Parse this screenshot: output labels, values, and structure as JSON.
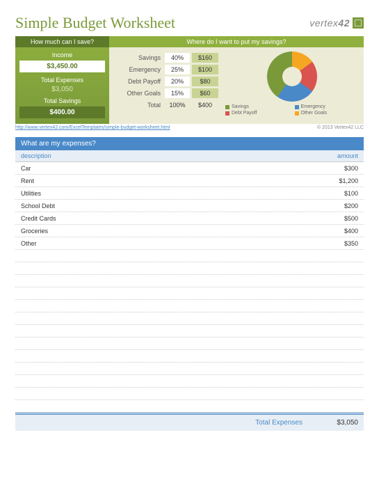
{
  "title": "Simple Budget Worksheet",
  "logo_text": "vertex",
  "logo_suffix": "42",
  "left": {
    "header": "How much can I save?",
    "income_label": "Income",
    "income_value": "$3,450.00",
    "expenses_label": "Total Expenses",
    "expenses_value": "$3,050",
    "savings_label": "Total Savings",
    "savings_value": "$400.00"
  },
  "right": {
    "header": "Where do I want to put my savings?",
    "rows": [
      {
        "label": "Savings",
        "pct": "40%",
        "amt": "$160"
      },
      {
        "label": "Emergency",
        "pct": "25%",
        "amt": "$100"
      },
      {
        "label": "Debt Payoff",
        "pct": "20%",
        "amt": "$80"
      },
      {
        "label": "Other Goals",
        "pct": "15%",
        "amt": "$60"
      }
    ],
    "total_label": "Total",
    "total_pct": "100%",
    "total_amt": "$400"
  },
  "chart_data": {
    "type": "pie",
    "title": "",
    "categories": [
      "Savings",
      "Emergency",
      "Debt Payoff",
      "Other Goals"
    ],
    "values": [
      40,
      25,
      20,
      15
    ],
    "colors": [
      "#7a9a3a",
      "#4a89c8",
      "#d9534f",
      "#f5a623"
    ],
    "legend": [
      {
        "label": "Savings",
        "color": "#7a9a3a"
      },
      {
        "label": "Emergency",
        "color": "#4a89c8"
      },
      {
        "label": "Debt Payoff",
        "color": "#d9534f"
      },
      {
        "label": "Other Goals",
        "color": "#f5a623"
      }
    ]
  },
  "source_link": "http://www.vertex42.com/ExcelTemplates/simple-budget-worksheet.html",
  "copyright": "© 2013 Vertex42 LLC",
  "expenses": {
    "header": "What are my expenses?",
    "col_desc": "description",
    "col_amt": "amount",
    "rows": [
      {
        "desc": "Car",
        "amt": "$300"
      },
      {
        "desc": "Rent",
        "amt": "$1,200"
      },
      {
        "desc": "Utilities",
        "amt": "$100"
      },
      {
        "desc": "School Debt",
        "amt": "$200"
      },
      {
        "desc": "Credit Cards",
        "amt": "$500"
      },
      {
        "desc": "Groceries",
        "amt": "$400"
      },
      {
        "desc": "Other",
        "amt": "$350"
      }
    ],
    "blank_count": 13,
    "total_label": "Total Expenses",
    "total_value": "$3,050"
  }
}
